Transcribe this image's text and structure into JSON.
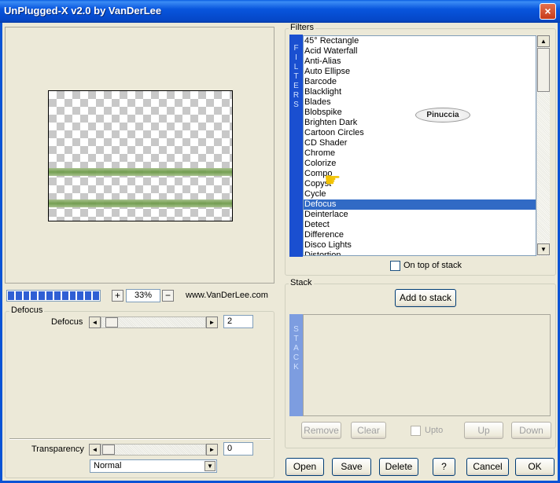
{
  "window": {
    "title": "UnPlugged-X v2.0 by VanDerLee",
    "close": "×"
  },
  "preview": {
    "zoom": "33%",
    "zoom_in": "+",
    "zoom_out": "−",
    "website": "www.VanDerLee.com",
    "progress_segments": 12
  },
  "filter_group": {
    "legend": "Defocus",
    "param_label": "Defocus",
    "param_value": "2",
    "left_arrow": "◄",
    "right_arrow": "►",
    "transparency_label": "Transparency",
    "transparency_value": "0",
    "blend_mode": "Normal"
  },
  "filters": {
    "legend": "Filters",
    "side_label": [
      "F",
      "I",
      "L",
      "T",
      "E",
      "R",
      "S"
    ],
    "items": [
      "45° Rectangle",
      "Acid Waterfall",
      "Anti-Alias",
      "Auto Ellipse",
      "Barcode",
      "Blacklight",
      "Blades",
      "Blobspike",
      "Brighten Dark",
      "Cartoon Circles",
      "CD Shader",
      "Chrome",
      "Colorize",
      "Compose",
      "Copystamp",
      "Cycle",
      "Defocus",
      "Deinterlace",
      "Detect",
      "Difference",
      "Disco Lights",
      "Distortion"
    ],
    "display_items": [
      "45° Rectangle",
      "Acid Waterfall",
      "Anti-Alias",
      "Auto Ellipse",
      "Barcode",
      "Blacklight",
      "Blades",
      "Blobspike",
      "Brighten Dark",
      "Cartoon Circles",
      "CD Shader",
      "Chrome",
      "Colorize",
      "Compo",
      "Copyst",
      "Cycle",
      "Defocus",
      "Deinterlace",
      "Detect",
      "Difference",
      "Disco Lights",
      "Distortion"
    ],
    "selected_index": 16,
    "ontop_label": "On top of stack",
    "watermark": "Pinuccia"
  },
  "stack": {
    "legend": "Stack",
    "add_button": "Add to stack",
    "side_label": [
      "S",
      "T",
      "A",
      "C",
      "K"
    ],
    "remove": "Remove",
    "clear": "Clear",
    "upto": "Upto",
    "up": "Up",
    "down": "Down"
  },
  "footer": {
    "open": "Open",
    "save": "Save",
    "delete": "Delete",
    "help": "?",
    "cancel": "Cancel",
    "ok": "OK"
  },
  "colors": {
    "titlebar": "#0855dd",
    "selection": "#316ac5",
    "sidebar": "#1a4fd0"
  }
}
